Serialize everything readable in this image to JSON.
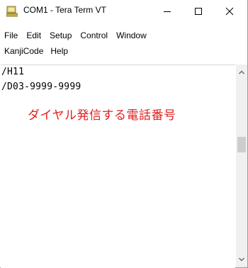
{
  "window": {
    "title": "COM1 - Tera Term VT",
    "icon": "tera-term-app-icon",
    "controls": {
      "minimize": "minimize-icon",
      "maximize": "maximize-icon",
      "close": "close-icon"
    }
  },
  "menu": {
    "row1": [
      "File",
      "Edit",
      "Setup",
      "Control",
      "Window"
    ],
    "row2": [
      "KanjiCode",
      "Help"
    ]
  },
  "terminal": {
    "lines": [
      "/H11",
      "/D03-9999-9999"
    ],
    "annotation": "ダイヤル発信する電話番号",
    "annotation_color": "#e02020"
  },
  "scrollbar": {
    "up_icon": "chevron-up-icon",
    "down_icon": "chevron-down-icon"
  }
}
